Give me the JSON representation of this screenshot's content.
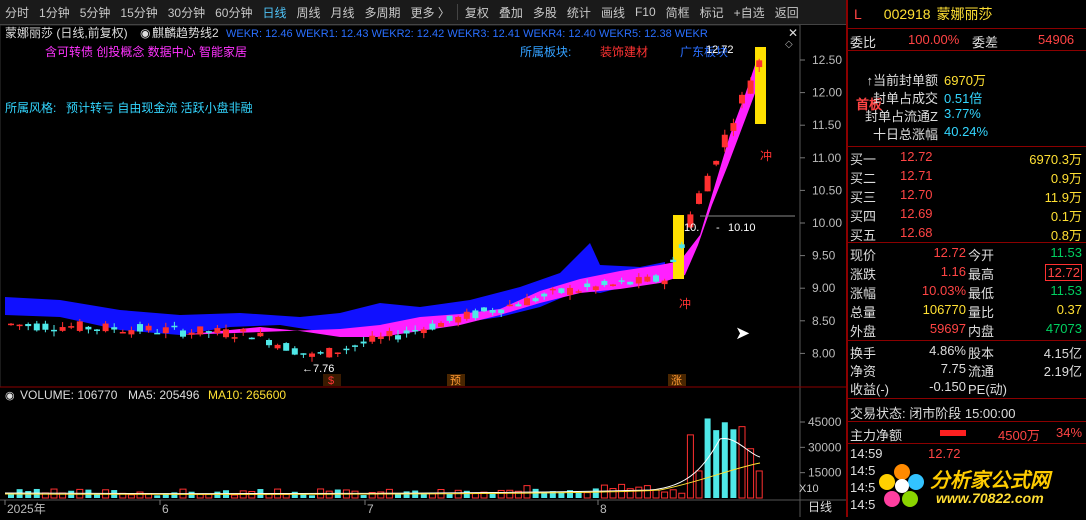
{
  "toolbar": {
    "items": [
      "分时",
      "1分钟",
      "5分钟",
      "15分钟",
      "30分钟",
      "60分钟",
      "日线",
      "周线",
      "月线",
      "多周期",
      "更多 〉",
      "复权",
      "叠加",
      "多股",
      "统计",
      "画线",
      "F10",
      "简框",
      "标记",
      "+自选",
      "返回"
    ],
    "active": "日线"
  },
  "chart": {
    "stock_label": "蒙娜丽莎 (日线,前复权)",
    "indicator_name": "麒麟趋势线2",
    "wekr_text": "WEKR: 12.46  WEKR1: 12.43  WEKR2: 12.42  WEKR3: 12.41  WEKR4: 12.40  WEKR5: 12.38  WEKR",
    "concepts": "含可转债 创投概念 数据中心 智能家居",
    "sector_label": "所属板块:",
    "sector_value": "装饰建材",
    "region": "广东板块",
    "style_label": "所属风格:",
    "style_value": "预计转亏 自由现金流 活跃小盘非融",
    "marker_chong1": "冲",
    "marker_chong2": "冲",
    "high_label": "12.72",
    "low_label": "←7.76",
    "mid_label_left": "10.",
    "mid_label_right": "10.10",
    "bottom_markers": [
      "$",
      "预",
      "涨"
    ],
    "volume_label": "VOLUME: 106770",
    "ma5_label": "MA5: 205496",
    "ma10_label": "MA10: 265600",
    "x10_label": "X10",
    "period_label": "日线",
    "date_labels": [
      "2025年",
      "6",
      "7",
      "8"
    ],
    "price_axis": [
      "12.50",
      "12.00",
      "11.50",
      "11.00",
      "10.50",
      "10.00",
      "9.50",
      "9.00",
      "8.50",
      "8.00"
    ],
    "vol_axis": [
      "45000",
      "30000",
      "15000"
    ],
    "colors": {
      "up": "#ff3030",
      "down": "#4fe8e8",
      "ribbon_blue": "#1010ff",
      "ribbon_magenta": "#ff20ff",
      "bull_bar": "#ffe000"
    }
  },
  "right": {
    "code_prefix": "L",
    "code": "002918",
    "name": "蒙娜丽莎",
    "weibi_label": "委比",
    "weibi_value": "100.00%",
    "weicha_label": "委差",
    "weicha_value": "54906",
    "shouban": "首板",
    "seal_rows": [
      {
        "label": "↑当前封单额",
        "value": "6970万"
      },
      {
        "label": "封单占成交",
        "value": "0.51倍"
      },
      {
        "label": "封单占流通Z",
        "value": "3.77%"
      },
      {
        "label": "十日总涨幅",
        "value": "40.24%"
      }
    ],
    "buy": [
      {
        "label": "买一",
        "price": "12.72",
        "vol": "6970.3万"
      },
      {
        "label": "买二",
        "price": "12.71",
        "vol": "0.9万"
      },
      {
        "label": "买三",
        "price": "12.70",
        "vol": "11.9万"
      },
      {
        "label": "买四",
        "price": "12.69",
        "vol": "0.1万"
      },
      {
        "label": "买五",
        "price": "12.68",
        "vol": "0.8万"
      }
    ],
    "quote": [
      {
        "l1": "现价",
        "v1": "12.72",
        "l2": "今开",
        "v2": "11.53"
      },
      {
        "l1": "涨跌",
        "v1": "1.16",
        "l2": "最高",
        "v2": "12.72"
      },
      {
        "l1": "涨幅",
        "v1": "10.03%",
        "l2": "最低",
        "v2": "11.53"
      },
      {
        "l1": "总量",
        "v1": "106770",
        "l2": "量比",
        "v2": "0.37"
      },
      {
        "l1": "外盘",
        "v1": "59697",
        "l2": "内盘",
        "v2": "47073"
      }
    ],
    "stats": [
      {
        "l1": "换手",
        "v1": "4.86%",
        "l2": "股本",
        "v2": "4.15亿"
      },
      {
        "l1": "净资",
        "v1": "7.75",
        "l2": "流通",
        "v2": "2.19亿"
      },
      {
        "l1": "收益(-)",
        "v1": "-0.150",
        "l2": "PE(动)",
        "v2": ""
      }
    ],
    "trade_status": "交易状态: 闭市阶段 15:00:00",
    "main_flow_label": "主力净额",
    "main_flow_value": "4500万",
    "main_flow_pct": "34%",
    "ticks": [
      {
        "time": "14:59",
        "price": "12.72"
      },
      {
        "time": "14:5",
        "price": ""
      },
      {
        "time": "14:5",
        "price": ""
      },
      {
        "time": "14:5",
        "price": ""
      }
    ],
    "watermark_cn": "分析家公式网",
    "watermark_url": "www.70822.com"
  }
}
